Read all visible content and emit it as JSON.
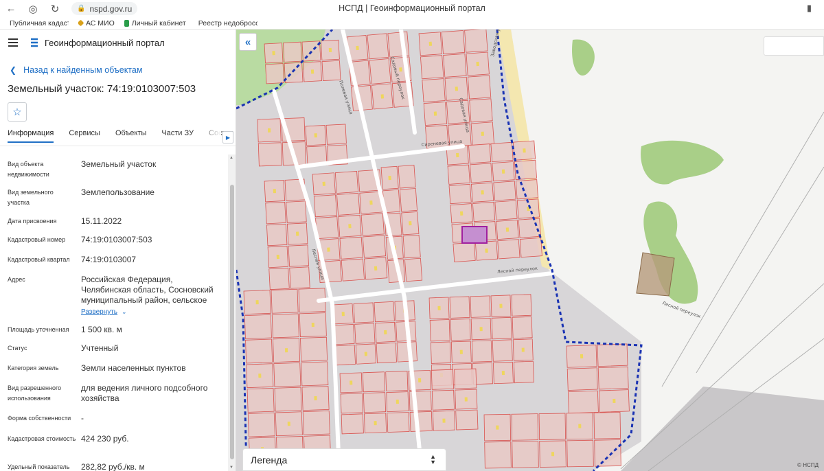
{
  "browser": {
    "url": "nspd.gov.ru",
    "title": "НСПД | Геоинформационный портал",
    "bookmarks": [
      "Публичная кадаст",
      "АС МИО",
      "Личный кабинет",
      "Реестр недобросс"
    ]
  },
  "panel": {
    "portal_name": "Геоинформационный портал",
    "back_label": "Назад к найденным объектам",
    "object_title": "Земельный участок: 74:19:0103007:503",
    "tabs": [
      "Информация",
      "Сервисы",
      "Объекты",
      "Части ЗУ",
      "Состав"
    ],
    "properties": [
      {
        "key": "Вид объекта недвижимости",
        "value": "Земельный участок"
      },
      {
        "key": "Вид земельного участка",
        "value": "Землепользование"
      },
      {
        "key": "Дата присвоения",
        "value": "15.11.2022"
      },
      {
        "key": "Кадастровый номер",
        "value": "74:19:0103007:503"
      },
      {
        "key": "Кадастровый квартал",
        "value": "74:19:0103007"
      },
      {
        "key": "Адрес",
        "value": "Российская Федерация, Челябинская область, Сосновский муниципальный район, сельское"
      },
      {
        "key": "Площадь уточненная",
        "value": "1 500 кв. м"
      },
      {
        "key": "Статус",
        "value": "Учтенный"
      },
      {
        "key": "Категория земель",
        "value": "Земли населенных пунктов"
      },
      {
        "key": "Вид разрешенного использования",
        "value": "для ведения личного подсобного хозяйства"
      },
      {
        "key": "Форма собственности",
        "value": "-"
      },
      {
        "key": "Кадастровая стоимость",
        "value": "424 230 руб."
      },
      {
        "key": "Удельный показатель",
        "value": "282,82 руб./кв. м"
      }
    ],
    "expand_label": "Развернуть"
  },
  "map": {
    "street_labels": [
      "Садовая улица",
      "Сиреневая улица",
      "Лесная улица",
      "Лесной переулок",
      "Лесной переулок",
      "Садовый переулок",
      "Полевая улица",
      "Заводская улица"
    ],
    "legend_label": "Легенда",
    "copyright": "© НСПД",
    "colors": {
      "parcel_fill": "#e9c9c6",
      "parcel_stroke": "#d9534f",
      "selected": "#a020a0",
      "boundary": "#1a33b3",
      "forest": "#a9cf88"
    }
  }
}
